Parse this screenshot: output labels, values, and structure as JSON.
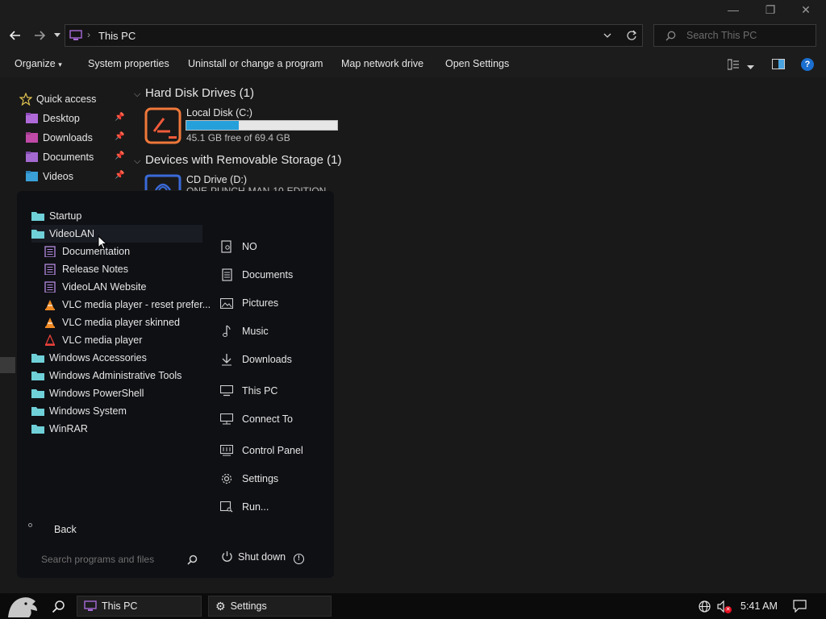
{
  "window": {
    "controls": {
      "minimize": "—",
      "maximize": "❐",
      "close": "✕"
    }
  },
  "address": {
    "breadcrumb_separator": "›",
    "location": "This PC",
    "search_placeholder": "Search This PC"
  },
  "commands": [
    {
      "label": "Organize",
      "has_dropdown": true
    },
    {
      "label": "System properties"
    },
    {
      "label": "Uninstall or change a program"
    },
    {
      "label": "Map network drive"
    },
    {
      "label": "Open Settings"
    }
  ],
  "nav": {
    "quick_access": "Quick access",
    "items": [
      {
        "label": "Desktop",
        "icon": "desktop-folder-icon",
        "pinned": true
      },
      {
        "label": "Downloads",
        "icon": "downloads-folder-icon",
        "pinned": true
      },
      {
        "label": "Documents",
        "icon": "documents-folder-icon",
        "pinned": true
      },
      {
        "label": "Videos",
        "icon": "videos-folder-icon",
        "pinned": true
      }
    ]
  },
  "content": {
    "groups": [
      {
        "label": "Hard Disk Drives (1)"
      },
      {
        "label": "Devices with Removable Storage (1)"
      }
    ],
    "drives": [
      {
        "name": "Local Disk (C:)",
        "free_text": "45.1 GB free of 69.4 GB",
        "used_fraction": 0.35
      },
      {
        "name": "CD Drive (D:)",
        "sub": "ONE-PUNCH-MAN-10-EDITION"
      }
    ]
  },
  "start_menu": {
    "programs": [
      {
        "label": "Startup",
        "type": "folder",
        "indent": 0
      },
      {
        "label": "VideoLAN",
        "type": "folder",
        "indent": 0,
        "hover": true
      },
      {
        "label": "Documentation",
        "type": "doc",
        "indent": 1
      },
      {
        "label": "Release Notes",
        "type": "doc",
        "indent": 1
      },
      {
        "label": "VideoLAN Website",
        "type": "doc",
        "indent": 1
      },
      {
        "label": "VLC media player - reset prefer...",
        "type": "vlc",
        "indent": 1
      },
      {
        "label": "VLC media player skinned",
        "type": "vlc",
        "indent": 1
      },
      {
        "label": "VLC media player",
        "type": "vlc-red",
        "indent": 1
      },
      {
        "label": "Windows Accessories",
        "type": "folder",
        "indent": 0
      },
      {
        "label": "Windows Administrative Tools",
        "type": "folder",
        "indent": 0
      },
      {
        "label": "Windows PowerShell",
        "type": "folder",
        "indent": 0
      },
      {
        "label": "Windows System",
        "type": "folder",
        "indent": 0
      },
      {
        "label": "WinRAR",
        "type": "folder",
        "indent": 0
      }
    ],
    "places": [
      {
        "label": "NO",
        "icon": "user-file-icon"
      },
      {
        "label": "Documents",
        "icon": "document-icon"
      },
      {
        "label": "Pictures",
        "icon": "picture-icon"
      },
      {
        "label": "Music",
        "icon": "music-icon"
      },
      {
        "label": "Downloads",
        "icon": "download-icon"
      },
      {
        "label": "This PC",
        "icon": "computer-icon"
      },
      {
        "label": "Connect To",
        "icon": "connect-icon"
      },
      {
        "label": "Control Panel",
        "icon": "control-panel-icon"
      },
      {
        "label": "Settings",
        "icon": "gear-icon"
      },
      {
        "label": "Run...",
        "icon": "run-icon"
      }
    ],
    "back": "Back",
    "search_placeholder": "Search programs and files",
    "shutdown": "Shut down"
  },
  "taskbar": {
    "buttons": [
      {
        "label": "This PC"
      },
      {
        "label": "Settings"
      }
    ],
    "time": "5:41 AM"
  },
  "colors": {
    "progress": "#26a0da",
    "folder": "#6fd0d8",
    "accent_purple": "#9b59b6"
  }
}
